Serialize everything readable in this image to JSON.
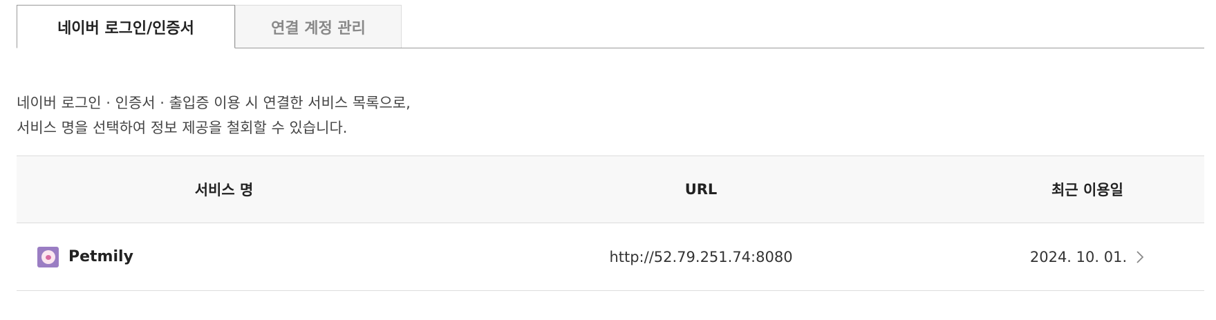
{
  "tabs": [
    {
      "label": "네이버 로그인/인증서",
      "active": true
    },
    {
      "label": "연결 계정 관리",
      "active": false
    }
  ],
  "description": {
    "line1": "네이버 로그인 · 인증서 · 출입증 이용 시 연결한 서비스 목록으로,",
    "line2": "서비스 명을 선택하여 정보 제공을 철회할 수 있습니다."
  },
  "table": {
    "headers": {
      "service": "서비스 명",
      "url": "URL",
      "date": "최근 이용일"
    },
    "rows": [
      {
        "service": "Petmily",
        "url": "http://52.79.251.74:8080",
        "date": "2024. 10. 01.",
        "icon": "petmily-logo-icon"
      }
    ]
  },
  "colors": {
    "icon_bg": "#9a7dc3",
    "header_bg": "#f8f8f8",
    "border": "#dcdcdc"
  }
}
